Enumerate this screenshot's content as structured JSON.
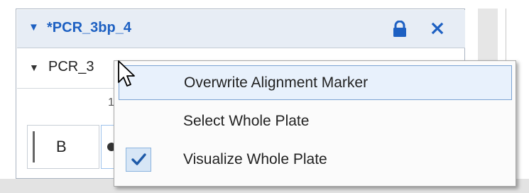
{
  "panel": {
    "title": "*PCR_3bp_4",
    "subtitle": "PCR_3",
    "header_icons": [
      "caret-down-icon",
      "lock-icon",
      "close-icon"
    ]
  },
  "plate": {
    "button_b_label": "B",
    "tick_label": "1"
  },
  "context_menu": {
    "items": [
      {
        "label": "Overwrite Alignment Marker",
        "checked": false,
        "highlighted": true
      },
      {
        "label": "Select Whole Plate",
        "checked": false,
        "highlighted": false
      },
      {
        "label": "Visualize Whole Plate",
        "checked": true,
        "highlighted": false
      }
    ]
  },
  "colors": {
    "accent": "#1d60c2",
    "header_bg": "#e7edf5",
    "menu_highlight": "#e8f1fc",
    "menu_highlight_border": "#7ba3d3",
    "check_color": "#1e5aa8",
    "side_glyph_color": "#7a2a8a"
  }
}
